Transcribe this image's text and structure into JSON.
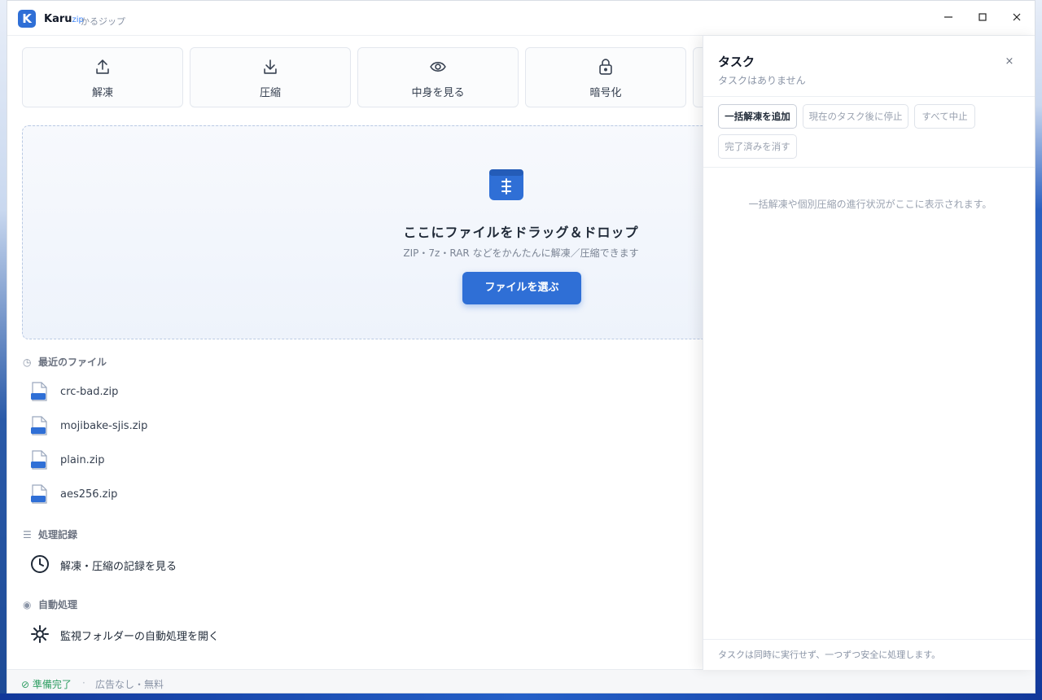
{
  "window": {
    "app_name": "Karu",
    "app_name_suffix": "zip",
    "app_subtitle": "かるジップ",
    "minimize": "—",
    "maximize": "☐",
    "close": "✕"
  },
  "toolbar": {
    "items": [
      {
        "label": "解凍",
        "icon": "upload-icon"
      },
      {
        "label": "圧縮",
        "icon": "download-icon"
      },
      {
        "label": "中身を見る",
        "icon": "eye-icon"
      },
      {
        "label": "暗号化",
        "icon": "lock-icon"
      }
    ]
  },
  "dropzone": {
    "title": "ここにファイルをドラッグ＆ドロップ",
    "subtitle": "ZIP・7z・RAR などをかんたんに解凍／圧縮できます",
    "button": "ファイルを選ぶ"
  },
  "recent": {
    "heading": "最近のファイル",
    "files": [
      {
        "name": "crc-bad.zip",
        "badge": ".zip"
      },
      {
        "name": "mojibake-sjis.zip",
        "badge": ".zip"
      },
      {
        "name": "plain.zip",
        "badge": ".zip"
      },
      {
        "name": "aes256.zip",
        "badge": ".zip"
      }
    ]
  },
  "history": {
    "heading": "処理記録",
    "link": "解凍・圧縮の記録を見る"
  },
  "auto": {
    "heading": "自動処理",
    "link": "監視フォルダーの自動処理を開く"
  },
  "status": {
    "ready": "準備完了",
    "separator": "·",
    "ad": "広告なし・無料"
  },
  "task_panel": {
    "title": "タスク",
    "subtitle": "タスクはありません",
    "close": "×",
    "buttons": {
      "add_batch": "一括解凍を追加",
      "stop_after": "現在のタスク後に停止",
      "stop_all": "すべて中止",
      "clear_done": "完了済みを消す"
    },
    "empty_message": "一括解凍や個別圧縮の進行状況がここに表示されます。",
    "footer": "タスクは同時に実行せず、一つずつ安全に処理します。"
  },
  "colors": {
    "accent": "#2f6fd6",
    "status_ok": "#2f9e63"
  }
}
